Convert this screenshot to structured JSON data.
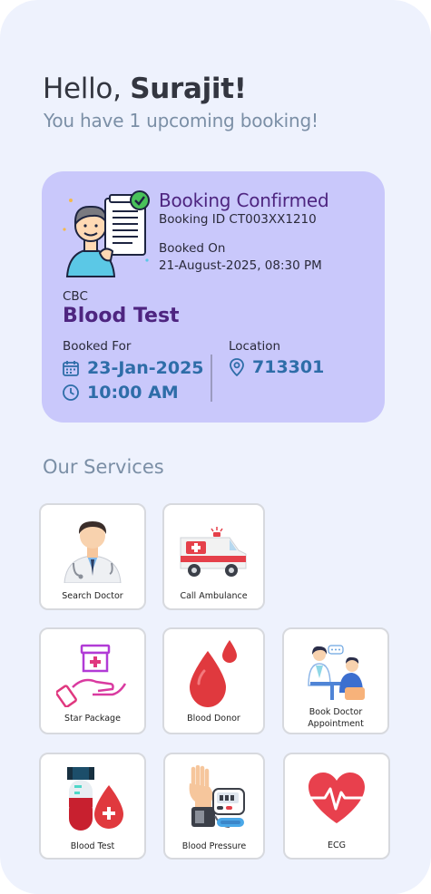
{
  "greeting": {
    "hello": "Hello, ",
    "name": "Surajit!",
    "subtitle": "You have 1 upcoming booking!"
  },
  "booking": {
    "status": "Booking Confirmed",
    "booking_id": "Booking ID CT003XX1210",
    "booked_on_label": "Booked On",
    "booked_on": "21-August-2025, 08:30 PM",
    "category": "CBC",
    "test_name": "Blood Test",
    "booked_for_label": "Booked For",
    "date": "23-Jan-2025",
    "time": "10:00 AM",
    "location_label": "Location",
    "location": "713301"
  },
  "services": {
    "title": "Our Services",
    "items": [
      {
        "label": "Search Doctor",
        "icon": "doctor-icon"
      },
      {
        "label": "Call Ambulance",
        "icon": "ambulance-icon"
      },
      {
        "label": "Star Package",
        "icon": "package-hand-icon"
      },
      {
        "label": "Blood Donor",
        "icon": "blood-drop-icon"
      },
      {
        "label": "Book Doctor Appointment",
        "icon": "consultation-icon"
      },
      {
        "label": "Blood Test",
        "icon": "test-tube-icon"
      },
      {
        "label": "Blood Pressure",
        "icon": "bp-monitor-icon"
      },
      {
        "label": "ECG",
        "icon": "heart-ecg-icon"
      }
    ]
  },
  "colors": {
    "background": "#eef2fd",
    "card": "#c9c8fb",
    "accent_purple": "#4e2580",
    "accent_blue": "#2e6da8",
    "muted": "#7b8fa6"
  }
}
